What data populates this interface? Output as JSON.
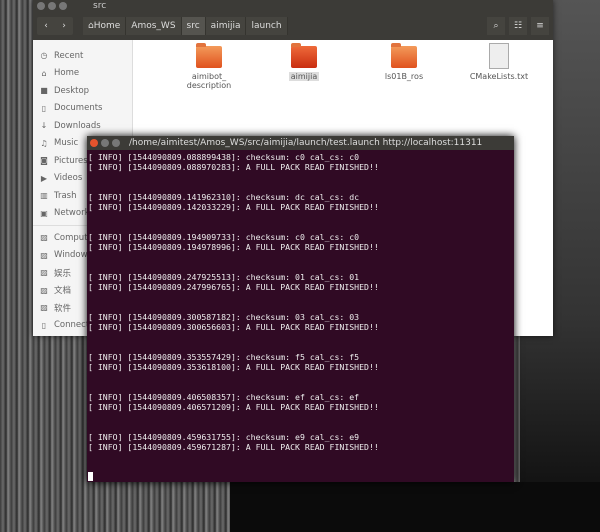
{
  "file_manager": {
    "title": "src",
    "nav": {
      "back": "‹",
      "forward": "›"
    },
    "breadcrumbs": [
      "⌂Home",
      "Amos_WS",
      "src",
      "aimijia",
      "launch"
    ],
    "current_crumb": "src",
    "toolbar_icons": [
      "search-icon",
      "grid-view-icon",
      "list-view-icon"
    ],
    "sidebar": [
      {
        "label": "Recent",
        "icon": "◷"
      },
      {
        "label": "Home",
        "icon": "⌂"
      },
      {
        "label": "Desktop",
        "icon": "■"
      },
      {
        "label": "Documents",
        "icon": "▯"
      },
      {
        "label": "Downloads",
        "icon": "↓"
      },
      {
        "label": "Music",
        "icon": "♫"
      },
      {
        "label": "Pictures",
        "icon": "◙"
      },
      {
        "label": "Videos",
        "icon": "▶"
      },
      {
        "label": "Trash",
        "icon": "▥"
      },
      {
        "label": "Network",
        "icon": "▣"
      }
    ],
    "devices": [
      {
        "label": "Computer",
        "icon": "▨"
      },
      {
        "label": "Windows",
        "icon": "▨"
      },
      {
        "label": "娱乐",
        "icon": "▨"
      },
      {
        "label": "文档",
        "icon": "▨"
      },
      {
        "label": "软件",
        "icon": "▨"
      },
      {
        "label": "Connect",
        "icon": "▯"
      }
    ],
    "files": [
      {
        "name": "aimibot_\ndescription",
        "type": "folder"
      },
      {
        "name": "aimijia",
        "type": "folder",
        "selected": true
      },
      {
        "name": "ls01B_ros",
        "type": "folder"
      },
      {
        "name": "CMakeLists.txt",
        "type": "text"
      }
    ]
  },
  "terminal": {
    "title": "/home/aimitest/Amos_WS/src/aimijia/launch/test.launch http://localhost:11311",
    "lines": [
      "[ INFO] [1544090809.088899438]: checksum: c0 cal_cs: c0",
      "[ INFO] [1544090809.088970283]: A FULL PACK READ FINISHED!!",
      "",
      "",
      "[ INFO] [1544090809.141962310]: checksum: dc cal_cs: dc",
      "[ INFO] [1544090809.142033229]: A FULL PACK READ FINISHED!!",
      "",
      "",
      "[ INFO] [1544090809.194909733]: checksum: c0 cal_cs: c0",
      "[ INFO] [1544090809.194978996]: A FULL PACK READ FINISHED!!",
      "",
      "",
      "[ INFO] [1544090809.247925513]: checksum: 01 cal_cs: 01",
      "[ INFO] [1544090809.247996765]: A FULL PACK READ FINISHED!!",
      "",
      "",
      "[ INFO] [1544090809.300587182]: checksum: 03 cal_cs: 03",
      "[ INFO] [1544090809.300656603]: A FULL PACK READ FINISHED!!",
      "",
      "",
      "[ INFO] [1544090809.353557429]: checksum: f5 cal_cs: f5",
      "[ INFO] [1544090809.353618100]: A FULL PACK READ FINISHED!!",
      "",
      "",
      "[ INFO] [1544090809.406508357]: checksum: ef cal_cs: ef",
      "[ INFO] [1544090809.406571209]: A FULL PACK READ FINISHED!!",
      "",
      "",
      "[ INFO] [1544090809.459631755]: checksum: e9 cal_cs: e9",
      "[ INFO] [1544090809.459671287]: A FULL PACK READ FINISHED!!",
      "",
      ""
    ]
  },
  "colors": {
    "terminal_bg": "#300a24",
    "folder": "#e0521e",
    "titlebar": "#3c3b37"
  }
}
